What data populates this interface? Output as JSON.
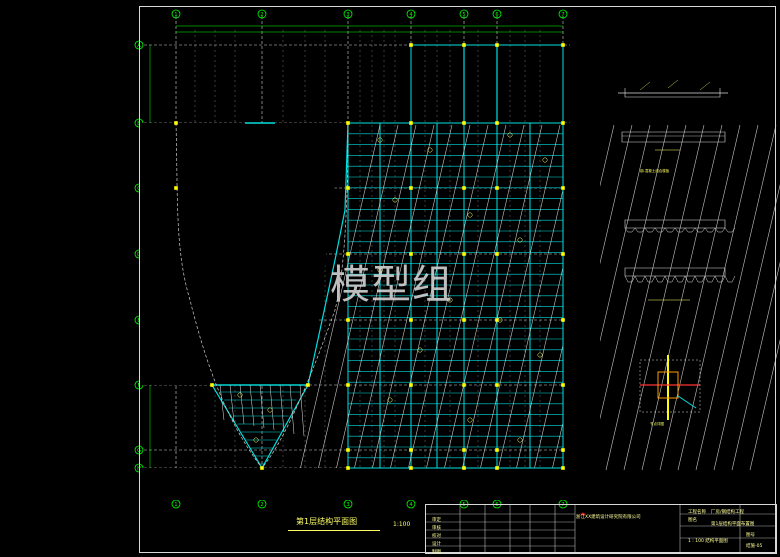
{
  "watermark": "模型组",
  "plan": {
    "title": "第1层结构平面图",
    "scale": "1:100"
  },
  "axes": {
    "columns": [
      "1",
      "2",
      "3",
      "4",
      "5",
      "6",
      "7"
    ],
    "rows": [
      "A",
      "B",
      "C",
      "D",
      "E",
      "F",
      "G",
      "H"
    ]
  },
  "colors": {
    "background": "#000000",
    "axis": "#00ff00",
    "beam": "#00e0e0",
    "grid_dash": "#cfcfcf",
    "text": "#ffff66",
    "frame": "#d8d8d8"
  },
  "details": {
    "section_note": "钢-混凝土组合楼板",
    "detail_note": "节点详图"
  },
  "titleblock": {
    "company": "浙江XX建筑设计研究院有限公司",
    "project_label": "工程名称",
    "project_name": "厂房/钢结构工程",
    "drawing_label": "图名",
    "drawing_name": "第1层结构平面布置图",
    "sheet_label": "图号",
    "sheet_no": "结施-05",
    "roles": [
      "审定",
      "审核",
      "校对",
      "设计",
      "制图"
    ],
    "drawing_small": "1 : 100 结构平面图"
  }
}
